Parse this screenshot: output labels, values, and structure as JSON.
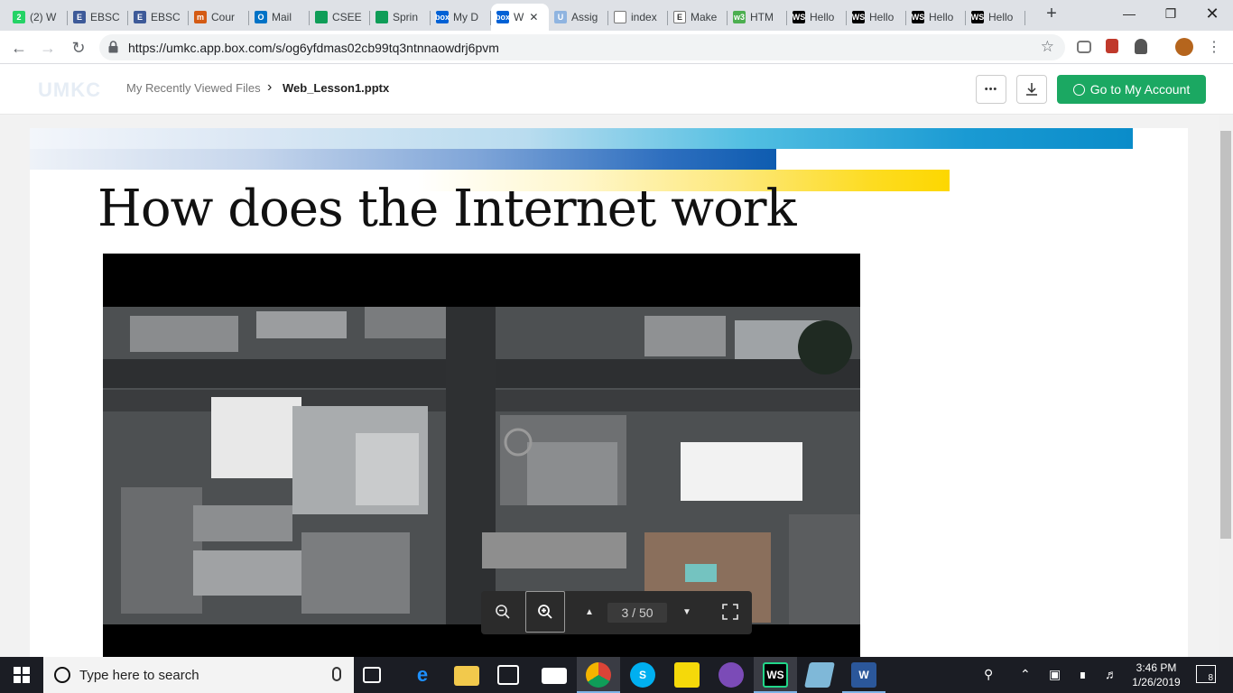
{
  "browser": {
    "tabs": [
      {
        "label": "(2) W",
        "icon": "whatsapp-icon",
        "color": "#25d366",
        "badge": "2"
      },
      {
        "label": "EBSC",
        "icon": "ebsco-icon",
        "color": "#3d5a99",
        "badge": "E"
      },
      {
        "label": "EBSC",
        "icon": "ebsco-icon",
        "color": "#3d5a99",
        "badge": "E"
      },
      {
        "label": "Cour",
        "icon": "coursera-icon",
        "color": "#d45b14",
        "badge": "m"
      },
      {
        "label": "Mail",
        "icon": "outlook-icon",
        "color": "#0072c6",
        "badge": "O"
      },
      {
        "label": "CSEE",
        "icon": "sheets-icon",
        "color": "#0f9d58",
        "badge": ""
      },
      {
        "label": "Sprin",
        "icon": "sheets-icon",
        "color": "#0f9d58",
        "badge": ""
      },
      {
        "label": "My D",
        "icon": "box-icon",
        "color": "#0061d5",
        "badge": "box"
      },
      {
        "label": "W",
        "icon": "box-icon",
        "color": "#0061d5",
        "badge": "box",
        "active": true
      },
      {
        "label": "Assig",
        "icon": "umkc-icon",
        "color": "#8fb4e0",
        "badge": "U"
      },
      {
        "label": "index",
        "icon": "file-icon",
        "color": "#ffffff",
        "badge": ""
      },
      {
        "label": "Make",
        "icon": "e-icon",
        "color": "#ffffff",
        "badge": "E"
      },
      {
        "label": "HTM",
        "icon": "w3-icon",
        "color": "#4caf50",
        "badge": "w3"
      },
      {
        "label": "Hello",
        "icon": "webstorm-icon",
        "color": "#000000",
        "badge": "WS"
      },
      {
        "label": "Hello",
        "icon": "webstorm-icon",
        "color": "#000000",
        "badge": "WS"
      },
      {
        "label": "Hello",
        "icon": "webstorm-icon",
        "color": "#000000",
        "badge": "WS"
      },
      {
        "label": "Hello",
        "icon": "webstorm-icon",
        "color": "#000000",
        "badge": "WS"
      }
    ],
    "new_tab": "+",
    "url": "https://umkc.app.box.com/s/og6yfdmas02cb99tq3ntnnaowdrj6pvm"
  },
  "header": {
    "logo": "UMKC",
    "breadcrumb_parent": "My Recently Viewed Files",
    "breadcrumb_sep": "›",
    "breadcrumb_file": "Web_Lesson1.pptx",
    "more_label": "•••",
    "go_account_label": "Go to My Account",
    "accent": "#1ba862"
  },
  "slide": {
    "title": "How does the Internet work"
  },
  "viewer": {
    "page_indicator": "3 / 50",
    "current_page": 3,
    "total_pages": 50
  },
  "taskbar": {
    "search_placeholder": "Type here to search",
    "time": "3:46 PM",
    "date": "1/26/2019",
    "notifications": "8"
  }
}
